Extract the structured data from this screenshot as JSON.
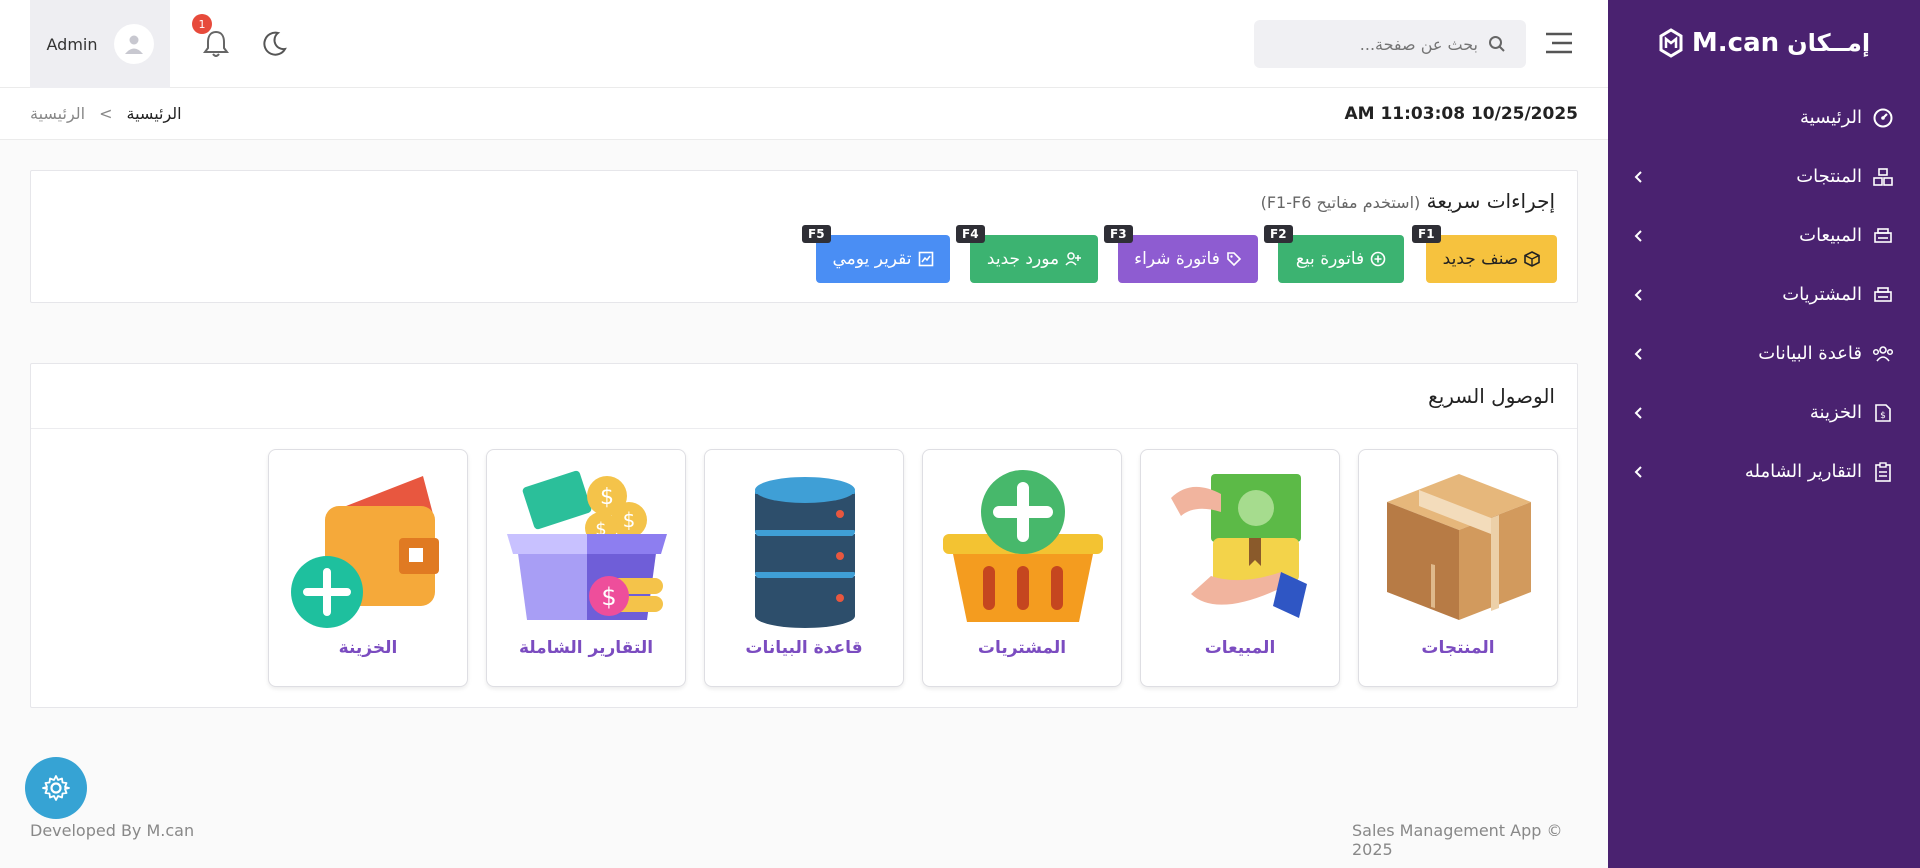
{
  "brand": {
    "name": "M.can",
    "arabic_name": "إمــكان"
  },
  "sidebar": {
    "items": [
      {
        "label": "الرئيسية",
        "icon": "dashboard-icon",
        "has_children": false
      },
      {
        "label": "المنتجات",
        "icon": "products-icon",
        "has_children": true
      },
      {
        "label": "المبيعات",
        "icon": "sales-icon",
        "has_children": true
      },
      {
        "label": "المشتريات",
        "icon": "purchases-icon",
        "has_children": true
      },
      {
        "label": "قاعدة البيانات",
        "icon": "database-icon",
        "has_children": true
      },
      {
        "label": "الخزينة",
        "icon": "treasury-icon",
        "has_children": true
      },
      {
        "label": "التقارير الشامله",
        "icon": "reports-icon",
        "has_children": true
      }
    ]
  },
  "topbar": {
    "user": "Admin",
    "notification_count": "1",
    "search_placeholder": "بحث عن صفحة..."
  },
  "breadcrumb": {
    "datetime": "AM 11:03:08 10/25/2025",
    "items": [
      "الرئيسية",
      "الرئيسية"
    ],
    "separator": "<"
  },
  "quick_actions": {
    "title": "إجراءات سريعة",
    "hint": "(استخدم مفاتيح F1-F6)",
    "buttons": [
      {
        "label": "صنف جديد",
        "key": "F1",
        "color": "#f6c23e",
        "text_color": "#222222"
      },
      {
        "label": "فاتورة بيع",
        "key": "F2",
        "color": "#3cb371",
        "text_color": "#ffffff"
      },
      {
        "label": "فاتورة شراء",
        "key": "F3",
        "color": "#8e5cd1",
        "text_color": "#ffffff"
      },
      {
        "label": "مورد جديد",
        "key": "F4",
        "color": "#3cb371",
        "text_color": "#ffffff"
      },
      {
        "label": "تقرير يومي",
        "key": "F5",
        "color": "#4a8ef4",
        "text_color": "#ffffff"
      }
    ]
  },
  "quick_access": {
    "title": "الوصول السريع",
    "tiles": [
      {
        "label": "المنتجات",
        "icon": "box-icon"
      },
      {
        "label": "المبيعات",
        "icon": "money-hand-icon"
      },
      {
        "label": "المشتريات",
        "icon": "basket-icon"
      },
      {
        "label": "قاعدة البيانات",
        "icon": "database-stack-icon"
      },
      {
        "label": "التقارير الشاملة",
        "icon": "reports-box-icon"
      },
      {
        "label": "الخزينة",
        "icon": "wallet-icon"
      }
    ]
  },
  "footer": {
    "left": "Developed By M.can",
    "right": "Sales Management App © 2025"
  },
  "colors": {
    "sidebar": "#4a2270",
    "accent": "#7b4cc0",
    "fab": "#36a3d4"
  }
}
